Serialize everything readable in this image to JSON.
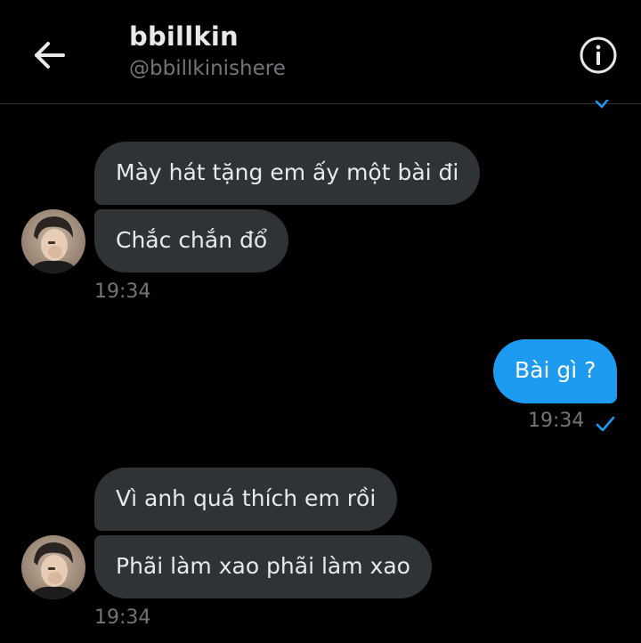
{
  "header": {
    "title": "bbillkin",
    "handle": "@bbillkinishere",
    "back_icon": "arrow-left-icon",
    "info_icon": "info-icon"
  },
  "colors": {
    "background": "#000000",
    "received_bubble": "#2f3336",
    "sent_bubble": "#1d9bf0",
    "muted_text": "#71767b",
    "check_color": "#1d9bf0"
  },
  "messages": [
    {
      "direction": "received",
      "text": "Mày hát tặng em ấy một bài đi"
    },
    {
      "direction": "received",
      "text": "Chắc chắn đổ"
    },
    {
      "direction": "sent",
      "text": "Bài gì ?"
    },
    {
      "direction": "received",
      "text": "Vì anh quá thích em rồi"
    },
    {
      "direction": "received",
      "text": "Phãi làm xao phãi làm xao"
    }
  ],
  "timestamps": {
    "group1": "19:34",
    "group2": "19:34",
    "group3": "19:34"
  },
  "status_icons": {
    "sent_read": "check-icon"
  }
}
